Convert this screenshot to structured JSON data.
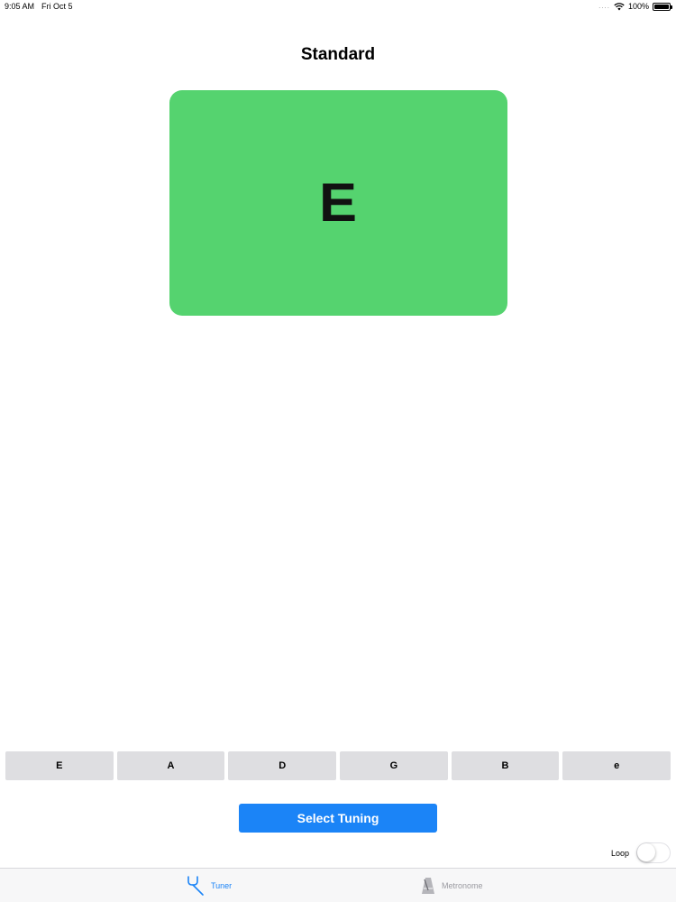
{
  "status_bar": {
    "time": "9:05 AM",
    "date": "Fri Oct 5",
    "signal": "....",
    "battery": "100%",
    "icons": {
      "wifi": "wifi-icon",
      "battery": "battery-icon"
    }
  },
  "title": "Standard",
  "note": {
    "letter": "E",
    "color": "#55d36f"
  },
  "strings": [
    {
      "label": "E"
    },
    {
      "label": "A"
    },
    {
      "label": "D"
    },
    {
      "label": "G"
    },
    {
      "label": "B"
    },
    {
      "label": "e"
    }
  ],
  "select_tuning": {
    "label": "Select Tuning",
    "color": "#1b84f7"
  },
  "loop": {
    "label": "Loop",
    "enabled": false
  },
  "tab_bar": {
    "tabs": [
      {
        "label": "Tuner",
        "icon": "tuning-fork-icon",
        "active": true
      },
      {
        "label": "Metronome",
        "icon": "metronome-icon",
        "active": false
      }
    ],
    "active_color": "#1b84f7",
    "inactive_color": "#9a9aa0"
  }
}
